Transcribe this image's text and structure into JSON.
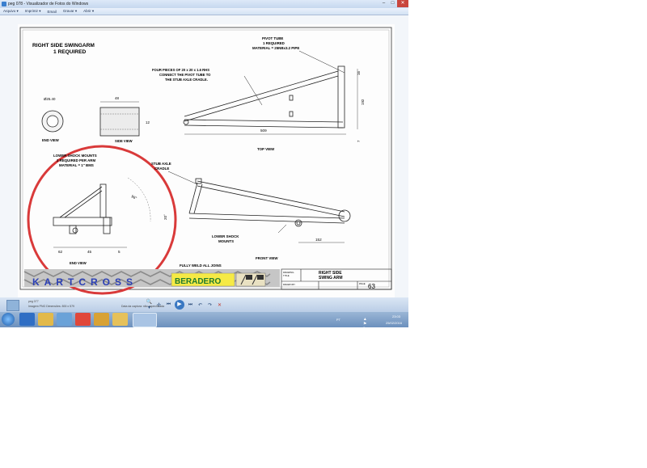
{
  "window": {
    "title": "peg 078 - Visualizador de Fotos do Windows",
    "controls": [
      "–",
      "□",
      "✕"
    ]
  },
  "menubar": {
    "items": [
      "Arquivo ▾",
      "Imprimir ▾",
      "Email",
      "Gravar ▾",
      "Abrir ▾"
    ]
  },
  "drawing": {
    "title_line1": "RIGHT SIDE SWINGARM",
    "title_line2": "1 REQUIRED",
    "pivot_line1": "PIVOT TUBE",
    "pivot_line2": "1 REQUIRED",
    "pivot_line3": "MATERIAL = 25NBx3.2 PIPE",
    "rhs_line1": "FOUR PIECES OF 20 x 20 x 1.6 RHS",
    "rhs_line2": "CONNECT THE PIVOT TUBE TO",
    "rhs_line3": "THE STUB AXLE CRADLE.",
    "dim_diam": "Ø25.40",
    "dim_48": "48",
    "dim_12": "12",
    "end_view": "END VIEW",
    "side_view": "SIDE VIEW",
    "dim_509": "509",
    "top_view": "TOP VIEW",
    "dim_16": "16",
    "dim_192": "192",
    "dim_7": "7",
    "lower_shock_line1": "LOWER SHOCK MOUNTS",
    "lower_shock_line2": "2 REQUIRED PER ARM",
    "lower_shock_line3": "MATERIAL = 1\" BMS",
    "stub_line1": "STUB AXLE",
    "stub_line2": "CRADLE",
    "dim_angle": "96°",
    "dim_20": "20°",
    "dim_62": "62",
    "dim_45": "45",
    "dim_5": "5",
    "end_view2": "END VIEW",
    "lower_shock2_line1": "LOWER SHOCK",
    "lower_shock2_line2": "MOUNTS",
    "dim_152": "152",
    "front_view": "FRONT VIEW",
    "weld_note": "FULLY WELD ALL JOINS",
    "tb_drawing_label1": "DRAWING",
    "tb_drawing_label2": "TITLE",
    "tb_title_line1": "RIGHT SIDE",
    "tb_title_line2": "SWING ARM",
    "tb_drawn_label": "DRAWN BY",
    "tb_page_label": "PAGE",
    "tb_page_num": "63",
    "brand_left": "KARTCROSS",
    "brand_right": "BERADERO"
  },
  "infobar": {
    "name": "peg 077",
    "line2": "Imagem PNG   Dimensões: 800 x 579",
    "line3": "Data da captura: não especificada"
  },
  "controls": {
    "zoom": "🔍▾",
    "fit": "✢",
    "prev": "⏮",
    "play": "▶",
    "next": "⏭",
    "rotate_ccw": "↶",
    "rotate_cw": "↷",
    "delete": "✕"
  },
  "tray": {
    "lang": "PT",
    "icons": "▲ ⚑ ▮ ◂)",
    "time": "23:03",
    "date": "25/02/2016"
  },
  "colors": {
    "circle": "#d93a3a",
    "brand_blue": "#2b3fb5",
    "brand_yellow": "#f6ea45",
    "brand_green": "#2a9a3a",
    "taskbar": "#7d9cc5"
  }
}
